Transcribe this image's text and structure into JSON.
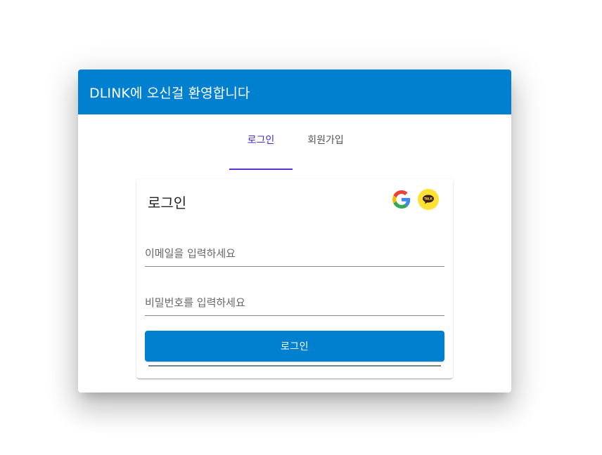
{
  "dialog": {
    "title": "DLINK에 오신걸 환영합니다"
  },
  "tabs": [
    {
      "label": "로그인",
      "active": true
    },
    {
      "label": "회원가입",
      "active": false
    }
  ],
  "login_card": {
    "title": "로그인",
    "social": [
      {
        "icon": "google-icon"
      },
      {
        "icon": "kakao-icon",
        "label": "TALK"
      }
    ],
    "email_field": {
      "placeholder": "이메일을 입력하세요",
      "value": ""
    },
    "password_field": {
      "placeholder": "비밀번호를 입력하세요",
      "value": ""
    },
    "submit_label": "로그인"
  },
  "colors": {
    "primary": "#0280d0",
    "tab_active": "#4a27d8",
    "kakao": "#fee233"
  }
}
